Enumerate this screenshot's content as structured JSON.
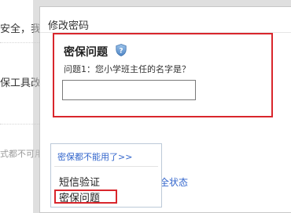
{
  "background": {
    "text_security": "安全，我",
    "text_tools": "保工具改",
    "text_unavailable": "式都不可用",
    "text_status": "全状态"
  },
  "modal": {
    "title": "修改密码",
    "qa": {
      "heading": "密保问题",
      "help_icon": "shield-question-icon",
      "question": "问题1：您小学班主任的名字是？",
      "answer_value": ""
    },
    "dropdown": {
      "toggle_label": "密保都不能用了>>",
      "items": [
        "短信验证",
        "密保问题"
      ]
    }
  },
  "colors": {
    "highlight_red": "#d9262c",
    "link_blue": "#3366cc"
  }
}
